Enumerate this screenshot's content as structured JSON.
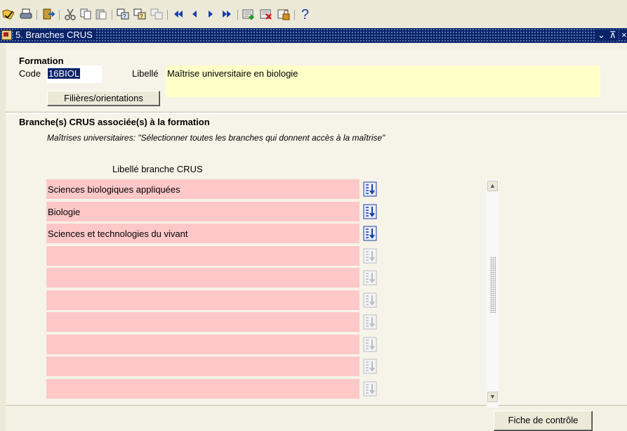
{
  "toolbar": {
    "icons": [
      "open-folder-icon",
      "print-icon",
      "exit-icon",
      "cut-icon",
      "copy-icon",
      "paste-icon",
      "copy-field-icon",
      "paste-field-icon",
      "clear-field-icon",
      "first-record-icon",
      "previous-record-icon",
      "next-record-icon",
      "last-record-icon",
      "insert-record-icon",
      "delete-record-icon",
      "lock-record-icon",
      "help-icon"
    ]
  },
  "window": {
    "title": "5. Branches CRUS",
    "minimize_glyph": "⌄",
    "maximize_glyph": "⊼",
    "close_glyph": "×"
  },
  "formation": {
    "heading": "Formation",
    "code_label": "Code",
    "code_value": "16BIOL",
    "libelle_label": "Libellé",
    "libelle_value": "Maîtrise universitaire en biologie",
    "filieres_button": "Filières/orientations"
  },
  "branches": {
    "heading": "Branche(s) CRUS associée(s) à la formation",
    "note": "Maîtrises universitaires: \"Sélectionner toutes les branches qui donnent accès à la maîtrise\"",
    "column_header": "Libellé branche CRUS",
    "rows": [
      "Sciences biologiques appliquées",
      "Biologie",
      "Sciences et technologies du vivant",
      "",
      "",
      "",
      "",
      "",
      "",
      ""
    ]
  },
  "footer": {
    "fiche_button": "Fiche de contrôle"
  },
  "colors": {
    "title_bar": "#0a246a",
    "row_field": "#ffc8c8",
    "libelle_field": "#ffffc8",
    "selection": "#0a246a"
  }
}
